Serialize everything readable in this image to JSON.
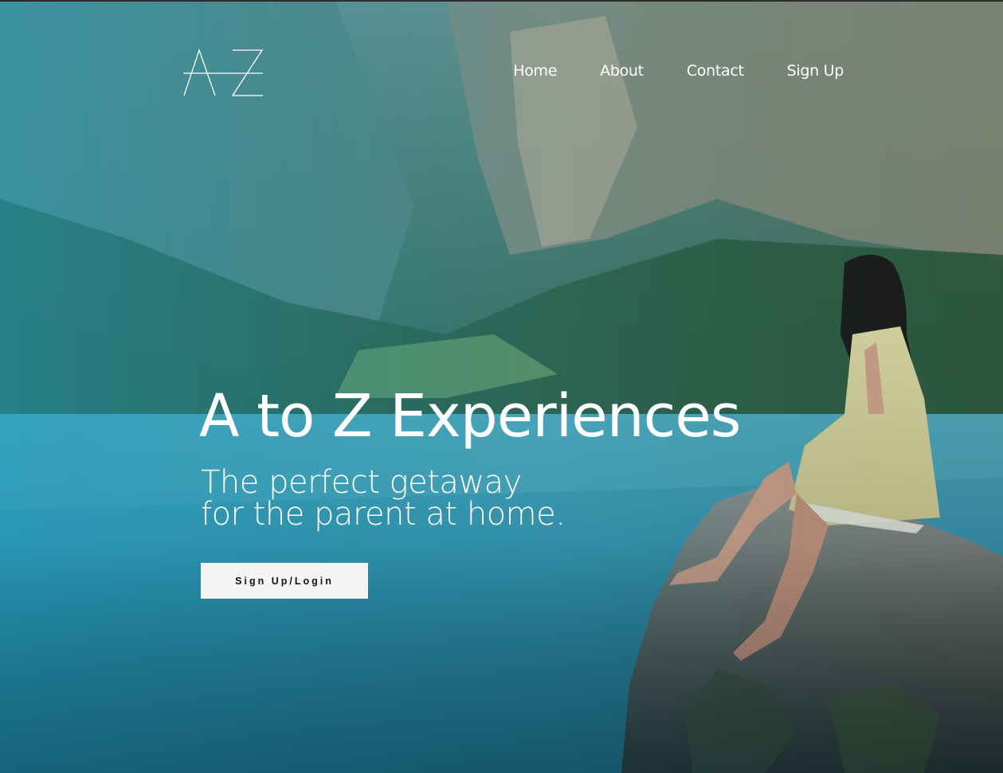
{
  "brand": {
    "logo_icon": "az-logo-icon"
  },
  "nav": {
    "items": [
      {
        "label": "Home"
      },
      {
        "label": "About"
      },
      {
        "label": "Contact"
      },
      {
        "label": "Sign Up"
      }
    ]
  },
  "hero": {
    "title": "A to Z Experiences",
    "subtitle_line1": "The perfect getaway",
    "subtitle_line2": "for the parent at home.",
    "cta_label": "Sign Up/Login",
    "background_image": "mountain-lake-woman-on-rock-photo"
  },
  "colors": {
    "overlay_teal": "#1e8fb0",
    "text": "#ffffff",
    "button_bg": "#f4f4f4",
    "button_text": "#111111"
  }
}
